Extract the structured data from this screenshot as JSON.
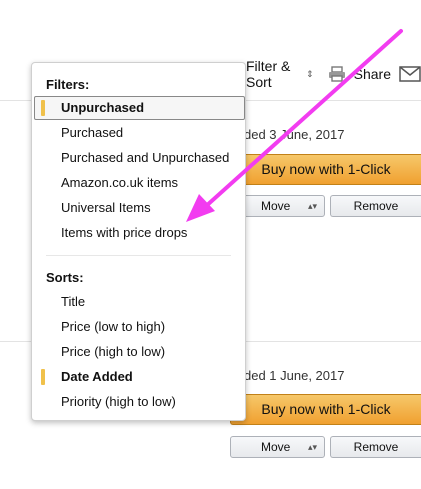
{
  "toolbar": {
    "filter_sort_label": "Filter & Sort",
    "filter_sort_caret": "⇕",
    "share_label": "Share"
  },
  "items": [
    {
      "added_date": "ded 3 June, 2017",
      "buy_label": "Buy now with 1-Click",
      "move_label": "Move",
      "remove_label": "Remove"
    },
    {
      "added_date": "ded 1 June, 2017",
      "buy_label": "Buy now with 1-Click",
      "move_label": "Move",
      "remove_label": "Remove"
    }
  ],
  "menu": {
    "filters_heading": "Filters:",
    "filters": [
      {
        "label": "Unpurchased",
        "selected": true
      },
      {
        "label": "Purchased",
        "selected": false
      },
      {
        "label": "Purchased and Unpurchased",
        "selected": false
      },
      {
        "label": "Amazon.co.uk items",
        "selected": false
      },
      {
        "label": "Universal Items",
        "selected": false
      },
      {
        "label": "Items with price drops",
        "selected": false
      }
    ],
    "sorts_heading": "Sorts:",
    "sorts": [
      {
        "label": "Title",
        "selected": false
      },
      {
        "label": "Price (low to high)",
        "selected": false
      },
      {
        "label": "Price (high to low)",
        "selected": false
      },
      {
        "label": "Date Added",
        "selected": true
      },
      {
        "label": "Priority (high to low)",
        "selected": false
      }
    ]
  },
  "colors": {
    "selected_marker": "#f0c14b",
    "buy_button": "#f0a030",
    "annotation_arrow": "#f23cf0"
  },
  "icons": [
    "print-icon",
    "mail-icon",
    "up-down-caret-icon"
  ]
}
